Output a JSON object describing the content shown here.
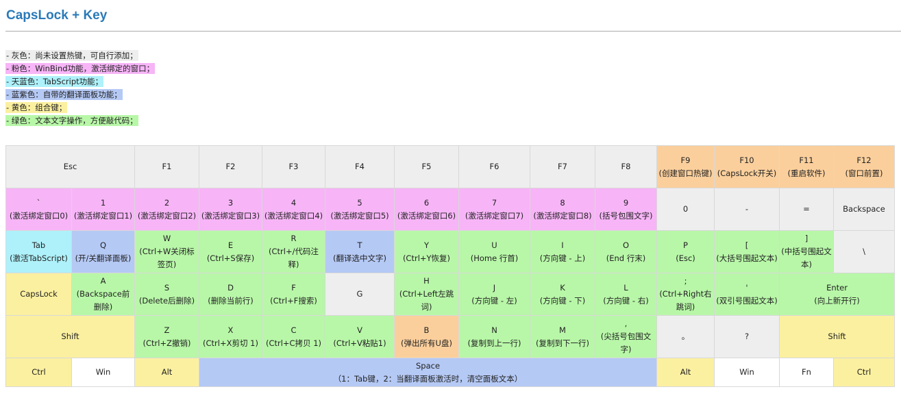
{
  "title": "CapsLock + Key",
  "legend": [
    {
      "text": "- 灰色：尚未设置热键，可自行添加；",
      "color": "#eeeeee"
    },
    {
      "text": "- 粉色：WinBind功能，激活绑定的窗口；",
      "color": "#f7b5f7"
    },
    {
      "text": "- 天蓝色：TabScript功能；",
      "color": "#aef1fa"
    },
    {
      "text": "- 蓝紫色：自带的翻译面板功能；",
      "color": "#b5c9f5"
    },
    {
      "text": "- 黄色：组合键；",
      "color": "#fbf0a0"
    },
    {
      "text": "- 绿色：文本文字操作，方便敲代码；",
      "color": "#b8f7a8"
    }
  ],
  "rows": [
    {
      "height": 62,
      "keys": [
        {
          "label": "Esc",
          "color": "gray",
          "span": 2,
          "name": "esc"
        },
        {
          "label": "F1",
          "color": "gray",
          "span": 1,
          "name": "f1"
        },
        {
          "label": "F2",
          "color": "gray",
          "span": 1,
          "name": "f2"
        },
        {
          "label": "F3",
          "color": "gray",
          "span": 1,
          "name": "f3"
        },
        {
          "label": "F4",
          "color": "gray",
          "span": 1,
          "name": "f4"
        },
        {
          "label": "F5",
          "color": "gray",
          "span": 1,
          "name": "f5"
        },
        {
          "label": "F6",
          "color": "gray",
          "span": 1,
          "name": "f6"
        },
        {
          "label": "F7",
          "color": "gray",
          "span": 1,
          "name": "f7"
        },
        {
          "label": "F8",
          "color": "gray",
          "span": 1,
          "name": "f8"
        },
        {
          "label": "F9",
          "desc": "(创建窗口热键)",
          "color": "orange",
          "span": 1,
          "name": "f9"
        },
        {
          "label": "F10",
          "desc": "(CapsLock开关)",
          "color": "orange",
          "span": 1,
          "name": "f10"
        },
        {
          "label": "F11",
          "desc": "(重启软件)",
          "color": "orange",
          "span": 1,
          "name": "f11"
        },
        {
          "label": "F12",
          "desc": "(窗口前置)",
          "color": "orange",
          "span": 1,
          "name": "f12"
        }
      ]
    },
    {
      "height": 62,
      "keys": [
        {
          "label": "`",
          "desc": "(激活绑定窗口0)",
          "color": "pink",
          "span": 1,
          "name": "backtick"
        },
        {
          "label": "1",
          "desc": "(激活绑定窗口1)",
          "color": "pink",
          "span": 1,
          "name": "1"
        },
        {
          "label": "2",
          "desc": "(激活绑定窗口2)",
          "color": "pink",
          "span": 1,
          "name": "2"
        },
        {
          "label": "3",
          "desc": "(激活绑定窗口3)",
          "color": "pink",
          "span": 1,
          "name": "3"
        },
        {
          "label": "4",
          "desc": "(激活绑定窗口4)",
          "color": "pink",
          "span": 1,
          "name": "4"
        },
        {
          "label": "5",
          "desc": "(激活绑定窗口5)",
          "color": "pink",
          "span": 1,
          "name": "5"
        },
        {
          "label": "6",
          "desc": "(激活绑定窗口6)",
          "color": "pink",
          "span": 1,
          "name": "6"
        },
        {
          "label": "7",
          "desc": "(激活绑定窗口7)",
          "color": "pink",
          "span": 1,
          "name": "7"
        },
        {
          "label": "8",
          "desc": "(激活绑定窗口8)",
          "color": "pink",
          "span": 1,
          "name": "8"
        },
        {
          "label": "9",
          "desc": "(括号包围文字)",
          "color": "pink",
          "span": 1,
          "name": "9"
        },
        {
          "label": "0",
          "color": "gray",
          "span": 1,
          "name": "0"
        },
        {
          "label": "-",
          "color": "gray",
          "span": 1,
          "name": "minus"
        },
        {
          "label": "=",
          "color": "gray",
          "span": 1,
          "name": "equals"
        },
        {
          "label": "Backspace",
          "color": "gray",
          "span": 1,
          "name": "backspace"
        }
      ]
    },
    {
      "height": 62,
      "keys": [
        {
          "label": "Tab",
          "desc": "(激活TabScript)",
          "color": "sky",
          "span": 1,
          "name": "tab"
        },
        {
          "label": "Q",
          "desc": "(开/关翻译面板)",
          "color": "blue",
          "span": 1,
          "name": "q"
        },
        {
          "label": "W",
          "desc": "(Ctrl+W关闭标签页)",
          "color": "green",
          "span": 1,
          "name": "w"
        },
        {
          "label": "E",
          "desc": "(Ctrl+S保存)",
          "color": "green",
          "span": 1,
          "name": "e"
        },
        {
          "label": "R",
          "desc": "(Ctrl+/代码注释)",
          "color": "green",
          "span": 1,
          "name": "r"
        },
        {
          "label": "T",
          "desc": "(翻译选中文字)",
          "color": "blue",
          "span": 1,
          "name": "t"
        },
        {
          "label": "Y",
          "desc": "(Ctrl+Y恢复)",
          "color": "green",
          "span": 1,
          "name": "y"
        },
        {
          "label": "U",
          "desc": "(Home 行首)",
          "color": "green",
          "span": 1,
          "name": "u"
        },
        {
          "label": "I",
          "desc": "(方向键 - 上)",
          "color": "green",
          "span": 1,
          "name": "i"
        },
        {
          "label": "O",
          "desc": "(End 行末)",
          "color": "green",
          "span": 1,
          "name": "o"
        },
        {
          "label": "P",
          "desc": "(Esc)",
          "color": "green",
          "span": 1,
          "name": "p"
        },
        {
          "label": "[",
          "desc": "(大括号围起文本)",
          "color": "green",
          "span": 1,
          "name": "left-bracket"
        },
        {
          "label": "]",
          "desc": "(中括号围起文本)",
          "color": "green",
          "span": 1,
          "name": "right-bracket"
        },
        {
          "label": "\\",
          "color": "gray",
          "span": 1,
          "name": "backslash"
        }
      ]
    },
    {
      "height": 62,
      "keys": [
        {
          "label": "CapsLock",
          "color": "yellow",
          "span": 1,
          "name": "capslock"
        },
        {
          "label": "A",
          "desc": "(Backspace前删除)",
          "color": "green",
          "span": 1,
          "name": "a"
        },
        {
          "label": "S",
          "desc": "(Delete后删除)",
          "color": "green",
          "span": 1,
          "name": "s"
        },
        {
          "label": "D",
          "desc": "(删除当前行)",
          "color": "green",
          "span": 1,
          "name": "d"
        },
        {
          "label": "F",
          "desc": "(Ctrl+F搜索)",
          "color": "green",
          "span": 1,
          "name": "f"
        },
        {
          "label": "G",
          "color": "gray",
          "span": 1,
          "name": "g"
        },
        {
          "label": "H",
          "desc": "(Ctrl+Left左跳词)",
          "color": "green",
          "span": 1,
          "name": "h"
        },
        {
          "label": "J",
          "desc": "(方向键 - 左)",
          "color": "green",
          "span": 1,
          "name": "j"
        },
        {
          "label": "K",
          "desc": "(方向键 - 下)",
          "color": "green",
          "span": 1,
          "name": "k"
        },
        {
          "label": "L",
          "desc": "(方向键 - 右)",
          "color": "green",
          "span": 1,
          "name": "l"
        },
        {
          "label": ";",
          "desc": "(Ctrl+Right右跳词)",
          "color": "green",
          "span": 1,
          "name": "semicolon"
        },
        {
          "label": "'",
          "desc": "(双引号围起文本)",
          "color": "green",
          "span": 1,
          "name": "quote"
        },
        {
          "label": "Enter",
          "desc": "(向上新开行)",
          "color": "green",
          "span": 2,
          "name": "enter"
        }
      ]
    },
    {
      "height": 62,
      "keys": [
        {
          "label": "Shift",
          "color": "yellow",
          "span": 2,
          "name": "shift-left"
        },
        {
          "label": "Z",
          "desc": "(Ctrl+Z撤销)",
          "color": "green",
          "span": 1,
          "name": "z"
        },
        {
          "label": "X",
          "desc": "(Ctrl+X剪切 1)",
          "color": "green",
          "span": 1,
          "name": "x"
        },
        {
          "label": "C",
          "desc": "(Ctrl+C拷贝 1)",
          "color": "green",
          "span": 1,
          "name": "c"
        },
        {
          "label": "V",
          "desc": "(Ctrl+V粘贴1)",
          "color": "green",
          "span": 1,
          "name": "v"
        },
        {
          "label": "B",
          "desc": "(弹出所有U盘)",
          "color": "orange",
          "span": 1,
          "name": "b"
        },
        {
          "label": "N",
          "desc": "(复制到上一行)",
          "color": "green",
          "span": 1,
          "name": "n"
        },
        {
          "label": "M",
          "desc": "(复制到下一行)",
          "color": "green",
          "span": 1,
          "name": "m"
        },
        {
          "label": ",",
          "desc": "(尖括号包围文字)",
          "color": "green",
          "span": 1,
          "name": "comma"
        },
        {
          "label": "。",
          "color": "gray",
          "span": 1,
          "name": "period"
        },
        {
          "label": "?",
          "color": "gray",
          "span": 1,
          "name": "question"
        },
        {
          "label": "Shift",
          "color": "yellow",
          "span": 2,
          "name": "shift-right"
        }
      ]
    },
    {
      "height": 42,
      "keys": [
        {
          "label": "Ctrl",
          "color": "yellow",
          "span": 1,
          "name": "ctrl-left"
        },
        {
          "label": "Win",
          "color": "white",
          "span": 1,
          "name": "win-left"
        },
        {
          "label": "Alt",
          "color": "yellow",
          "span": 1,
          "name": "alt-left"
        },
        {
          "label": "Space",
          "desc": "（1：Tab键，2：当翻译面板激活时，清空面板文本）",
          "color": "blue",
          "span": 7,
          "name": "space"
        },
        {
          "label": "Alt",
          "color": "yellow",
          "span": 1,
          "name": "alt-right"
        },
        {
          "label": "Win",
          "color": "white",
          "span": 1,
          "name": "win-right"
        },
        {
          "label": "Fn",
          "color": "white",
          "span": 1,
          "name": "fn"
        },
        {
          "label": "Ctrl",
          "color": "yellow",
          "span": 1,
          "name": "ctrl-right"
        }
      ]
    }
  ]
}
